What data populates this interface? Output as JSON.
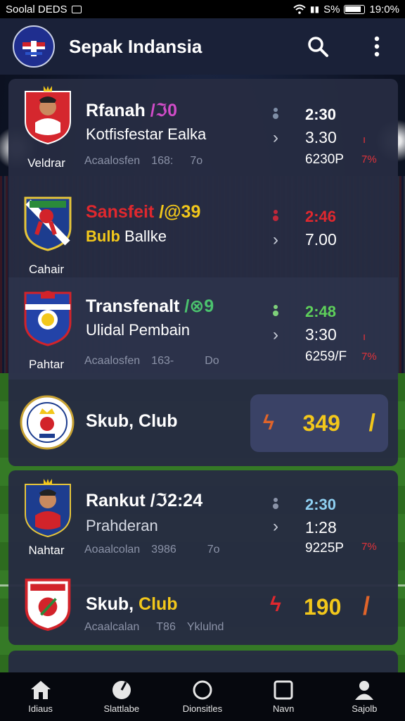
{
  "status_bar": {
    "left_text": "Soolal DEDS",
    "battery_text": "S%",
    "time": "19:0%"
  },
  "app_bar": {
    "title": "Sepak Indansia"
  },
  "matches": [
    {
      "title": "Rfanah",
      "title_tag": "/ℑ0",
      "subtitle": "Kotfisfestar Ealka",
      "crest_label": "Veldrar",
      "meta": [
        "Acaalosfen",
        "168:",
        "7o"
      ],
      "time": "2:30",
      "score": "3.30",
      "odds": "6230P",
      "odds_pct": "7%",
      "colors": {
        "time": "#ffffff",
        "tag": "#d14cc8",
        "dot": "#7f8ea6"
      }
    },
    {
      "title": "Sansfeit",
      "title_tag": "/@39",
      "subtitle_accent": "Bulb",
      "subtitle": "Ballke",
      "crest_label": "Cahair",
      "time": "2:46",
      "score": "7.00",
      "colors": {
        "title": "#e0282e",
        "tag": "#f2c71b",
        "time": "#e0282e",
        "dot": "#c0283a"
      }
    },
    {
      "title": "Transfenalt",
      "title_tag": "/⊗9",
      "subtitle": "Ulidal Pembain",
      "crest_label": "Pahtar",
      "meta": [
        "Acaalosfen",
        "163-",
        "Do"
      ],
      "time": "2:48",
      "score": "3:30",
      "odds": "6259/F",
      "odds_pct": "7%",
      "colors": {
        "time": "#5ed05a",
        "tag": "#4bc46e",
        "dot": "#7ed07a"
      }
    },
    {
      "title": "Skub, Club",
      "highlight_value": "349",
      "colors": {
        "highlight": "#f2c71b"
      }
    },
    {
      "title": "Rankut",
      "title_tag": "/ℑ2:24",
      "subtitle": "Prahderan",
      "crest_label": "Nahtar",
      "meta": [
        "Aoaalcolan",
        "3986",
        "7o"
      ],
      "time": "2:30",
      "score": "1:28",
      "odds": "9225P",
      "odds_pct": "7%",
      "colors": {
        "time": "#8fd0f2",
        "dot": "#8a93a8"
      }
    },
    {
      "title": "Skub,",
      "title_accent": "Club",
      "highlight_value": "190",
      "meta": [
        "Acaalcalan",
        "T86",
        "Yklulnd"
      ],
      "colors": {
        "accent": "#f2c71b",
        "highlight": "#f2c71b"
      }
    }
  ],
  "nav": [
    {
      "label": "Idiaus",
      "icon": "home-icon"
    },
    {
      "label": "Slattlabe",
      "icon": "stats-icon"
    },
    {
      "label": "Dionsitles",
      "icon": "circle-icon"
    },
    {
      "label": "Navn",
      "icon": "news-icon"
    },
    {
      "label": "Sajolb",
      "icon": "profile-icon"
    }
  ]
}
